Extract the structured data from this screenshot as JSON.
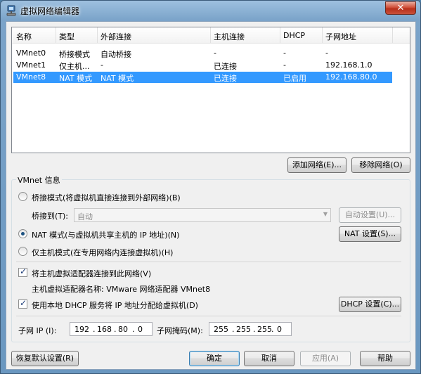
{
  "window": {
    "title": "虚拟网络编辑器",
    "close_label": "✕"
  },
  "netlist": {
    "columns": [
      "名称",
      "类型",
      "外部连接",
      "主机连接",
      "DHCP",
      "子网地址"
    ],
    "rows": [
      {
        "name": "VMnet0",
        "type": "桥接模式",
        "external": "自动桥接",
        "host": "-",
        "dhcp": "-",
        "subnet": "-"
      },
      {
        "name": "VMnet1",
        "type": "仅主机...",
        "external": "-",
        "host": "已连接",
        "dhcp": "-",
        "subnet": "192.168.1.0"
      },
      {
        "name": "VMnet8",
        "type": "NAT 模式",
        "external": "NAT 模式",
        "host": "已连接",
        "dhcp": "已启用",
        "subnet": "192.168.80.0"
      }
    ],
    "selected_index": 2
  },
  "buttons": {
    "add_network": "添加网络(E)...",
    "remove_network": "移除网络(O)",
    "auto_settings": "自动设置(U)...",
    "nat_settings": "NAT 设置(S)...",
    "dhcp_settings": "DHCP 设置(C)...",
    "restore_defaults": "恢复默认设置(R)",
    "ok": "确定",
    "cancel": "取消",
    "apply": "应用(A)",
    "help": "帮助"
  },
  "vmnet_info": {
    "legend": "VMnet 信息",
    "bridged_mode": "桥接模式(将虚拟机直接连接到外部网络)(B)",
    "bridged_to_label": "桥接到(T):",
    "bridged_to_value": "自动",
    "nat_mode": "NAT 模式(与虚拟机共享主机的 IP 地址)(N)",
    "host_only_mode": "仅主机模式(在专用网络内连接虚拟机)(H)",
    "selected_mode": "nat",
    "connect_host_adapter": "将主机虚拟适配器连接到此网络(V)",
    "connect_host_adapter_checked": true,
    "host_adapter_name": "主机虚拟适配器名称: VMware 网络适配器 VMnet8",
    "use_dhcp": "使用本地 DHCP 服务将 IP 地址分配给虚拟机(D)",
    "use_dhcp_checked": true,
    "subnet_ip_label": "子网 IP (I):",
    "subnet_ip": [
      "192",
      "168",
      "80",
      "0"
    ],
    "subnet_mask_label": "子网掩码(M):",
    "subnet_mask": [
      "255",
      "255",
      "255",
      "0"
    ]
  },
  "colors": {
    "selection": "#3399ff",
    "titlebar": "#7aa3c9",
    "close": "#c8503a"
  }
}
